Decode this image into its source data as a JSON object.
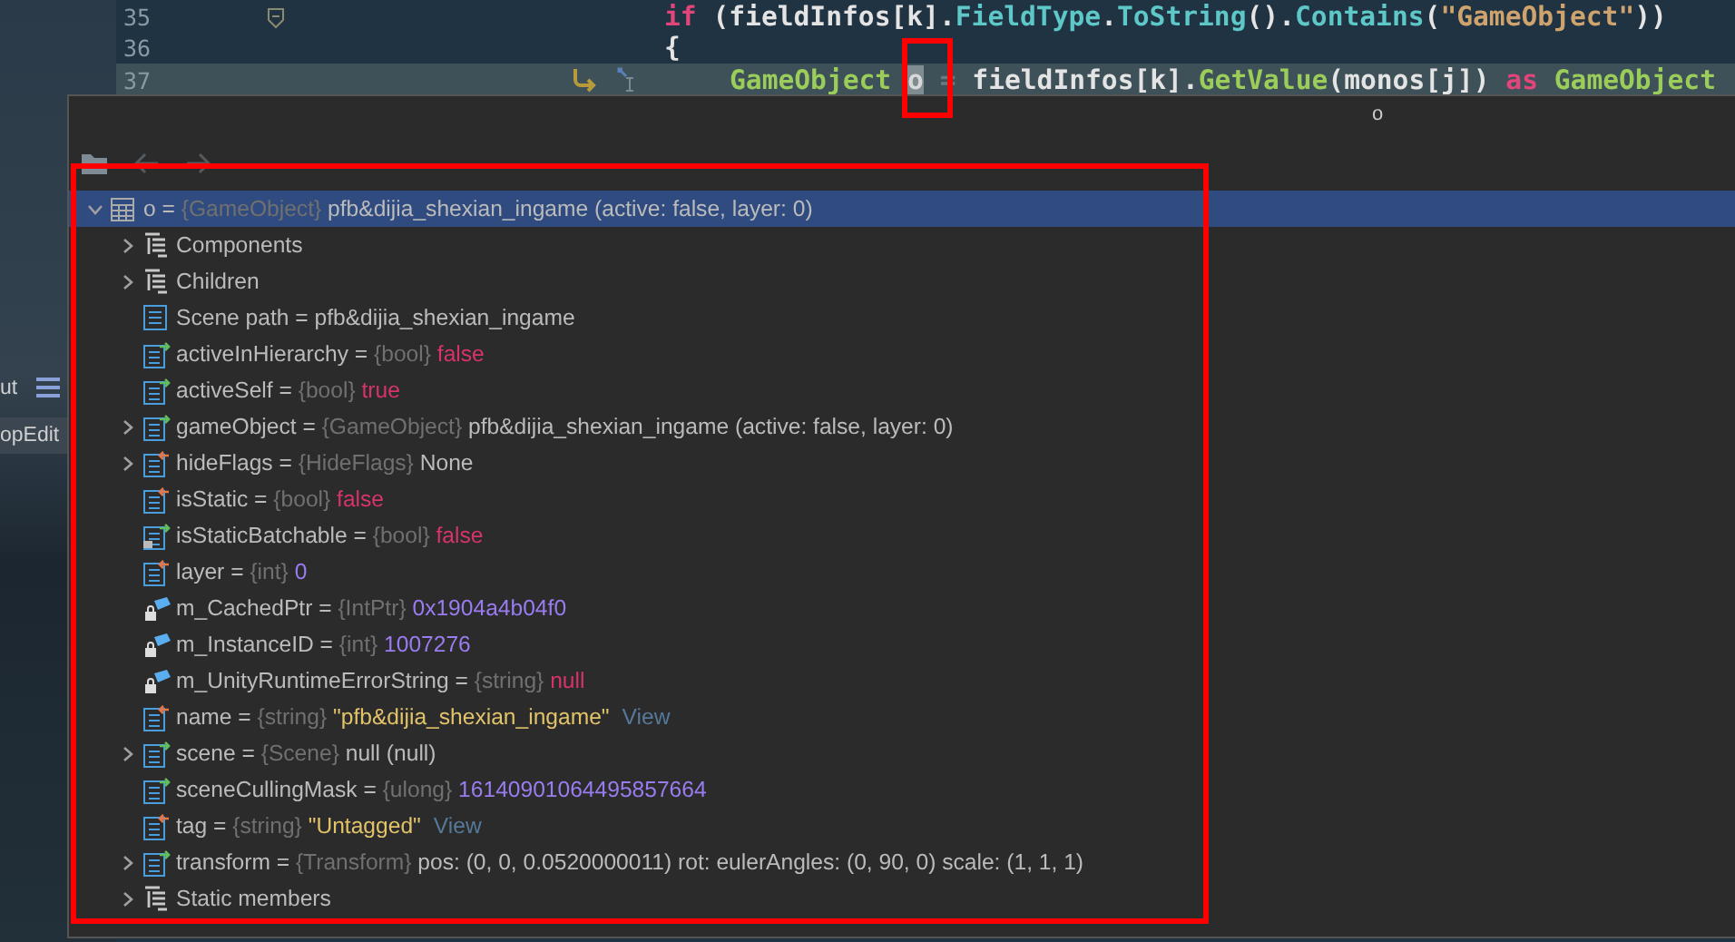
{
  "sidebar": {
    "items": [
      {
        "label": "ut",
        "selected": false
      },
      {
        "label": "opEdit",
        "selected": true
      }
    ]
  },
  "editor": {
    "lines": [
      {
        "number": "35",
        "current": false,
        "tokens": [
          {
            "text": "if",
            "kind": "keyword"
          },
          {
            "text": " (fieldInfos[k].",
            "kind": "plain"
          },
          {
            "text": "FieldType",
            "kind": "member"
          },
          {
            "text": ".",
            "kind": "plain"
          },
          {
            "text": "ToString",
            "kind": "member"
          },
          {
            "text": "().",
            "kind": "plain"
          },
          {
            "text": "Contains",
            "kind": "member"
          },
          {
            "text": "(",
            "kind": "plain"
          },
          {
            "text": "\"GameObject\"",
            "kind": "string"
          },
          {
            "text": "))",
            "kind": "plain"
          }
        ]
      },
      {
        "number": "36",
        "current": false,
        "tokens": [
          {
            "text": "{",
            "kind": "plain"
          }
        ]
      },
      {
        "number": "37",
        "current": true,
        "tokens": [
          {
            "text": "GameObject ",
            "kind": "type"
          },
          {
            "text": "o",
            "kind": "focus"
          },
          {
            "text": " = ",
            "kind": "dim"
          },
          {
            "text": "fieldInfos[k].",
            "kind": "plain"
          },
          {
            "text": "GetValue",
            "kind": "type"
          },
          {
            "text": "(monos[j]) ",
            "kind": "plain"
          },
          {
            "text": "as",
            "kind": "keyword"
          },
          {
            "text": " GameObject",
            "kind": "type"
          }
        ]
      }
    ]
  },
  "popup": {
    "tooltip": "o",
    "toolbar": [
      {
        "kind": "folder",
        "disabled": false
      },
      {
        "kind": "back",
        "disabled": true
      },
      {
        "kind": "forward",
        "disabled": true
      }
    ],
    "tree": [
      {
        "kind": "object",
        "name": "o =",
        "type": "{GameObject}",
        "value": {
          "text": "pfb&dijia_shexian_ingame (active: false, layer: 0)",
          "kind": "plain"
        },
        "expandable": true,
        "expanded": true,
        "selected": true,
        "children": [
          {
            "kind": "group",
            "name": "Components",
            "expandable": true,
            "expanded": false,
            "selected": false
          },
          {
            "kind": "group",
            "name": "Children",
            "expandable": true,
            "expanded": false,
            "selected": false
          },
          {
            "kind": "info",
            "name": "Scene path =",
            "value": {
              "text": "pfb&dijia_shexian_ingame",
              "kind": "plain"
            },
            "expandable": false,
            "selected": false
          },
          {
            "kind": "property",
            "name": "activeInHierarchy =",
            "type": "{bool}",
            "value": {
              "text": "false",
              "kind": "keyword"
            },
            "expandable": false,
            "selected": false
          },
          {
            "kind": "property",
            "name": "activeSelf =",
            "type": "{bool}",
            "value": {
              "text": "true",
              "kind": "keyword"
            },
            "expandable": false,
            "selected": false
          },
          {
            "kind": "property",
            "name": "gameObject =",
            "type": "{GameObject}",
            "value": {
              "text": "pfb&dijia_shexian_ingame (active: false, layer: 0)",
              "kind": "plain"
            },
            "expandable": true,
            "expanded": false,
            "selected": false
          },
          {
            "kind": "inherited",
            "name": "hideFlags =",
            "type": "{HideFlags}",
            "value": {
              "text": "None",
              "kind": "plain"
            },
            "expandable": true,
            "expanded": false,
            "selected": false
          },
          {
            "kind": "inherited",
            "name": "isStatic =",
            "type": "{bool}",
            "value": {
              "text": "false",
              "kind": "keyword"
            },
            "expandable": false,
            "selected": false
          },
          {
            "kind": "static",
            "name": "isStaticBatchable =",
            "type": "{bool}",
            "value": {
              "text": "false",
              "kind": "keyword"
            },
            "expandable": false,
            "selected": false
          },
          {
            "kind": "inherited",
            "name": "layer =",
            "type": "{int}",
            "value": {
              "text": "0",
              "kind": "number"
            },
            "expandable": false,
            "selected": false
          },
          {
            "kind": "private",
            "name": "m_CachedPtr =",
            "type": "{IntPtr}",
            "value": {
              "text": "0x1904a4b04f0",
              "kind": "number"
            },
            "expandable": false,
            "selected": false
          },
          {
            "kind": "private",
            "name": "m_InstanceID =",
            "type": "{int}",
            "value": {
              "text": "1007276",
              "kind": "number"
            },
            "expandable": false,
            "selected": false
          },
          {
            "kind": "private",
            "name": "m_UnityRuntimeErrorString =",
            "type": "{string}",
            "value": {
              "text": "null",
              "kind": "keyword"
            },
            "expandable": false,
            "selected": false
          },
          {
            "kind": "inherited",
            "name": "name =",
            "type": "{string}",
            "value": {
              "text": "\"pfb&dijia_shexian_ingame\"",
              "kind": "string"
            },
            "link": "View",
            "expandable": false,
            "selected": false
          },
          {
            "kind": "property",
            "name": "scene =",
            "type": "{Scene}",
            "value": {
              "text": "null (null)",
              "kind": "plain"
            },
            "expandable": true,
            "expanded": false,
            "selected": false
          },
          {
            "kind": "property",
            "name": "sceneCullingMask =",
            "type": "{ulong}",
            "value": {
              "text": "16140901064495857664",
              "kind": "number"
            },
            "expandable": false,
            "selected": false
          },
          {
            "kind": "inherited",
            "name": "tag =",
            "type": "{string}",
            "value": {
              "text": "\"Untagged\"",
              "kind": "string"
            },
            "link": "View",
            "expandable": false,
            "selected": false
          },
          {
            "kind": "property",
            "name": "transform =",
            "type": "{Transform}",
            "value": {
              "text": "pos: (0, 0, 0.0520000011) rot: eulerAngles: (0, 90, 0) scale: (1, 1, 1)",
              "kind": "plain"
            },
            "expandable": true,
            "expanded": false,
            "selected": false
          },
          {
            "kind": "group",
            "name": "Static members",
            "expandable": true,
            "expanded": false,
            "selected": false
          }
        ]
      }
    ]
  }
}
